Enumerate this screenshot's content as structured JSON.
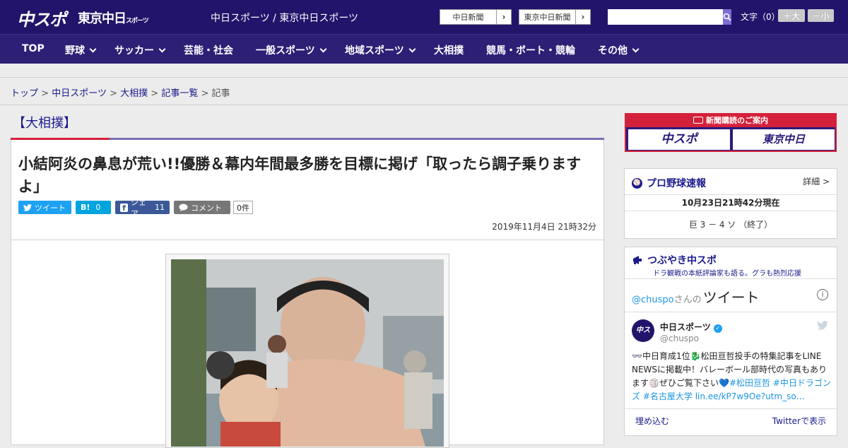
{
  "header": {
    "logo_main": "中スポ",
    "logo_tokyo": "東京中日",
    "logo_tokyo_sub": "スポーツ",
    "site_title": "中日スポーツ / 東京中日スポーツ",
    "ext_links": [
      "中日新聞",
      "東京中日新聞"
    ],
    "search_placeholder": "",
    "font_size_label": "文字（0）",
    "font_plus": "＋大",
    "font_minus": "－小"
  },
  "nav": {
    "items": [
      {
        "label": "TOP",
        "dropdown": false
      },
      {
        "label": "野球",
        "dropdown": true
      },
      {
        "label": "サッカー",
        "dropdown": true
      },
      {
        "label": "芸能・社会",
        "dropdown": false
      },
      {
        "label": "一般スポーツ",
        "dropdown": true
      },
      {
        "label": "地域スポーツ",
        "dropdown": true
      },
      {
        "label": "大相撲",
        "dropdown": false
      },
      {
        "label": "競馬・ボート・競輪",
        "dropdown": false
      },
      {
        "label": "その他",
        "dropdown": true
      }
    ]
  },
  "breadcrumb": {
    "items": [
      "トップ",
      "中日スポーツ",
      "大相撲",
      "記事一覧"
    ],
    "current": "記事",
    "sep": ">"
  },
  "article": {
    "section": "【大相撲】",
    "title": "小結阿炎の鼻息が荒い!!優勝＆幕内年間最多勝を目標に掲げ「取ったら調子乗りますよ」",
    "share": {
      "tweet": "ツイート",
      "hatena_label": "B!",
      "hatena_count": "0",
      "facebook": "シェア",
      "facebook_count": "11",
      "comment": "コメント",
      "comment_count": "0件"
    },
    "date": "2019年11月4日 21時32分"
  },
  "sidebar": {
    "subscribe": {
      "title": "新聞購読のご案内",
      "buttons": [
        "中スポ",
        "東京中日"
      ]
    },
    "baseball": {
      "title": "プロ野球速報",
      "detail": "詳細 >",
      "updated": "10月23日21時42分現在",
      "score": "巨 3 － 4 ソ （終了）"
    },
    "twitter": {
      "title": "つぶやき中スポ",
      "subtitle": "ドラ観戦の本紙評論家も語る。グラも熱烈応援",
      "handle_prefix": "@chuspo",
      "handle_suffix": "さんの",
      "tweets_label": "ツイート",
      "account_name": "中日スポーツ",
      "account_handle": "@chuspo",
      "tweet_text_1": "中日育成1位",
      "tweet_text_2": "松田亘哲投手の特集記事をLINE NEWSに掲載中！バレーボール部時代の写真もあります",
      "tweet_text_3": "ぜひご覧下さい",
      "tags": "#松田亘哲 #中日ドラゴンズ #名古屋大学",
      "link": "lin.ee/kP7w9Oe?utm_so…",
      "embed": "埋め込む",
      "view_on_twitter": "Twitterで表示"
    }
  },
  "colors": {
    "header_bg": "#22146a",
    "nav_bg": "#2d1f76",
    "accent_red": "#d4213b",
    "link": "#1a1a8c"
  }
}
